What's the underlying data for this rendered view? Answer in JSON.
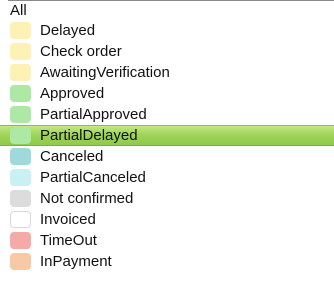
{
  "dropdown": {
    "all_label": "All",
    "selected_index": 4,
    "items": [
      {
        "label": "Delayed",
        "swatch_color": "#fdf2b3"
      },
      {
        "label": "Check order",
        "swatch_color": "#fdf2b3"
      },
      {
        "label": "AwaitingVerification",
        "swatch_color": "#fdf2b3"
      },
      {
        "label": "Approved",
        "swatch_color": "#ade8a5"
      },
      {
        "label": "PartialApproved",
        "swatch_color": "#ade8a5"
      },
      {
        "label": "PartialDelayed",
        "swatch_color": "#ade8a5"
      },
      {
        "label": "Canceled",
        "swatch_color": "#9fd9dc"
      },
      {
        "label": "PartialCanceled",
        "swatch_color": "#c9f1f3"
      },
      {
        "label": "Not confirmed",
        "swatch_color": "#dcdcdc"
      },
      {
        "label": "Invoiced",
        "swatch_color": "#ffffff"
      },
      {
        "label": "TimeOut",
        "swatch_color": "#f5a9a9"
      },
      {
        "label": "InPayment",
        "swatch_color": "#f7c9a5"
      }
    ]
  }
}
